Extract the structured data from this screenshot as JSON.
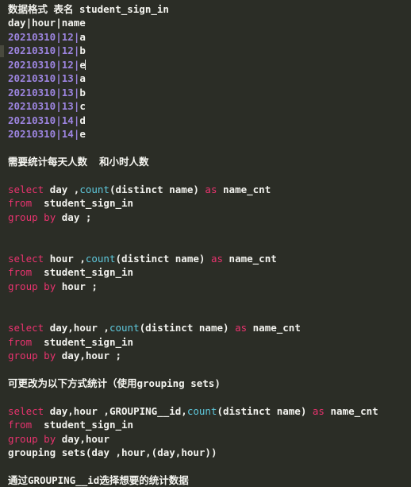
{
  "editor": {
    "background_color": "#2b2d26",
    "colors": {
      "keyword": "#e8336e",
      "function": "#5fc9dd",
      "number": "#9d85e0",
      "text": "#f2f2ee",
      "gutter_marker": "#494a3e"
    },
    "caret_line_index": 4,
    "caret_after_text": "b"
  },
  "lines": [
    {
      "id": "l1",
      "kind": "heading-cn",
      "text": "数据格式 表名 student_sign_in"
    },
    {
      "id": "l2",
      "kind": "plain",
      "text": "day|hour|name"
    },
    {
      "id": "l3",
      "kind": "record",
      "num": "20210310",
      "sep1": "|",
      "hour": "12",
      "sep2": "|",
      "name": "a"
    },
    {
      "id": "l4",
      "kind": "record",
      "num": "20210310",
      "sep1": "|",
      "hour": "12",
      "sep2": "|",
      "name": "b"
    },
    {
      "id": "l5",
      "kind": "record",
      "num": "20210310",
      "sep1": "|",
      "hour": "12",
      "sep2": "|",
      "name": "e"
    },
    {
      "id": "l6",
      "kind": "record",
      "num": "20210310",
      "sep1": "|",
      "hour": "13",
      "sep2": "|",
      "name": "a"
    },
    {
      "id": "l7",
      "kind": "record",
      "num": "20210310",
      "sep1": "|",
      "hour": "13",
      "sep2": "|",
      "name": "b"
    },
    {
      "id": "l8",
      "kind": "record",
      "num": "20210310",
      "sep1": "|",
      "hour": "13",
      "sep2": "|",
      "name": "c"
    },
    {
      "id": "l9",
      "kind": "record",
      "num": "20210310",
      "sep1": "|",
      "hour": "14",
      "sep2": "|",
      "name": "d"
    },
    {
      "id": "l10",
      "kind": "record",
      "num": "20210310",
      "sep1": "|",
      "hour": "14",
      "sep2": "|",
      "name": "e"
    },
    {
      "id": "l11",
      "kind": "blank",
      "text": ""
    },
    {
      "id": "l12",
      "kind": "note-cn",
      "text": "需要统计每天人数  和小时人数"
    },
    {
      "id": "l13",
      "kind": "blank",
      "text": ""
    },
    {
      "id": "l14",
      "kind": "sql",
      "text": "select day ,count(distinct name) as name_cnt"
    },
    {
      "id": "l15",
      "kind": "sql",
      "text": "from  student_sign_in"
    },
    {
      "id": "l16",
      "kind": "sql",
      "text": "group by day ;"
    },
    {
      "id": "l17",
      "kind": "blank",
      "text": ""
    },
    {
      "id": "l18",
      "kind": "blank",
      "text": ""
    },
    {
      "id": "l19",
      "kind": "sql",
      "text": "select hour ,count(distinct name) as name_cnt"
    },
    {
      "id": "l20",
      "kind": "sql",
      "text": "from  student_sign_in"
    },
    {
      "id": "l21",
      "kind": "sql",
      "text": "group by hour ;"
    },
    {
      "id": "l22",
      "kind": "blank",
      "text": ""
    },
    {
      "id": "l23",
      "kind": "blank",
      "text": ""
    },
    {
      "id": "l24",
      "kind": "sql",
      "text": "select day,hour ,count(distinct name) as name_cnt"
    },
    {
      "id": "l25",
      "kind": "sql",
      "text": "from  student_sign_in"
    },
    {
      "id": "l26",
      "kind": "sql",
      "text": "group by day,hour ;"
    },
    {
      "id": "l27",
      "kind": "blank",
      "text": ""
    },
    {
      "id": "l28",
      "kind": "note-cn",
      "text": "可更改为以下方式统计（使用grouping sets)"
    },
    {
      "id": "l29",
      "kind": "blank",
      "text": ""
    },
    {
      "id": "l30",
      "kind": "sql",
      "text": "select day,hour ,GROUPING__id,count(distinct name) as name_cnt"
    },
    {
      "id": "l31",
      "kind": "sql",
      "text": "from  student_sign_in"
    },
    {
      "id": "l32",
      "kind": "sql",
      "text": "group by day,hour"
    },
    {
      "id": "l33",
      "kind": "sql",
      "text": "grouping sets(day ,hour,(day,hour))"
    },
    {
      "id": "l34",
      "kind": "blank",
      "text": ""
    },
    {
      "id": "l35",
      "kind": "note-cn",
      "text": "通过GROUPING__id选择想要的统计数据"
    }
  ],
  "sql_keywords": [
    "select",
    "from",
    "group",
    "by",
    "as"
  ],
  "sql_functions": [
    "count"
  ]
}
